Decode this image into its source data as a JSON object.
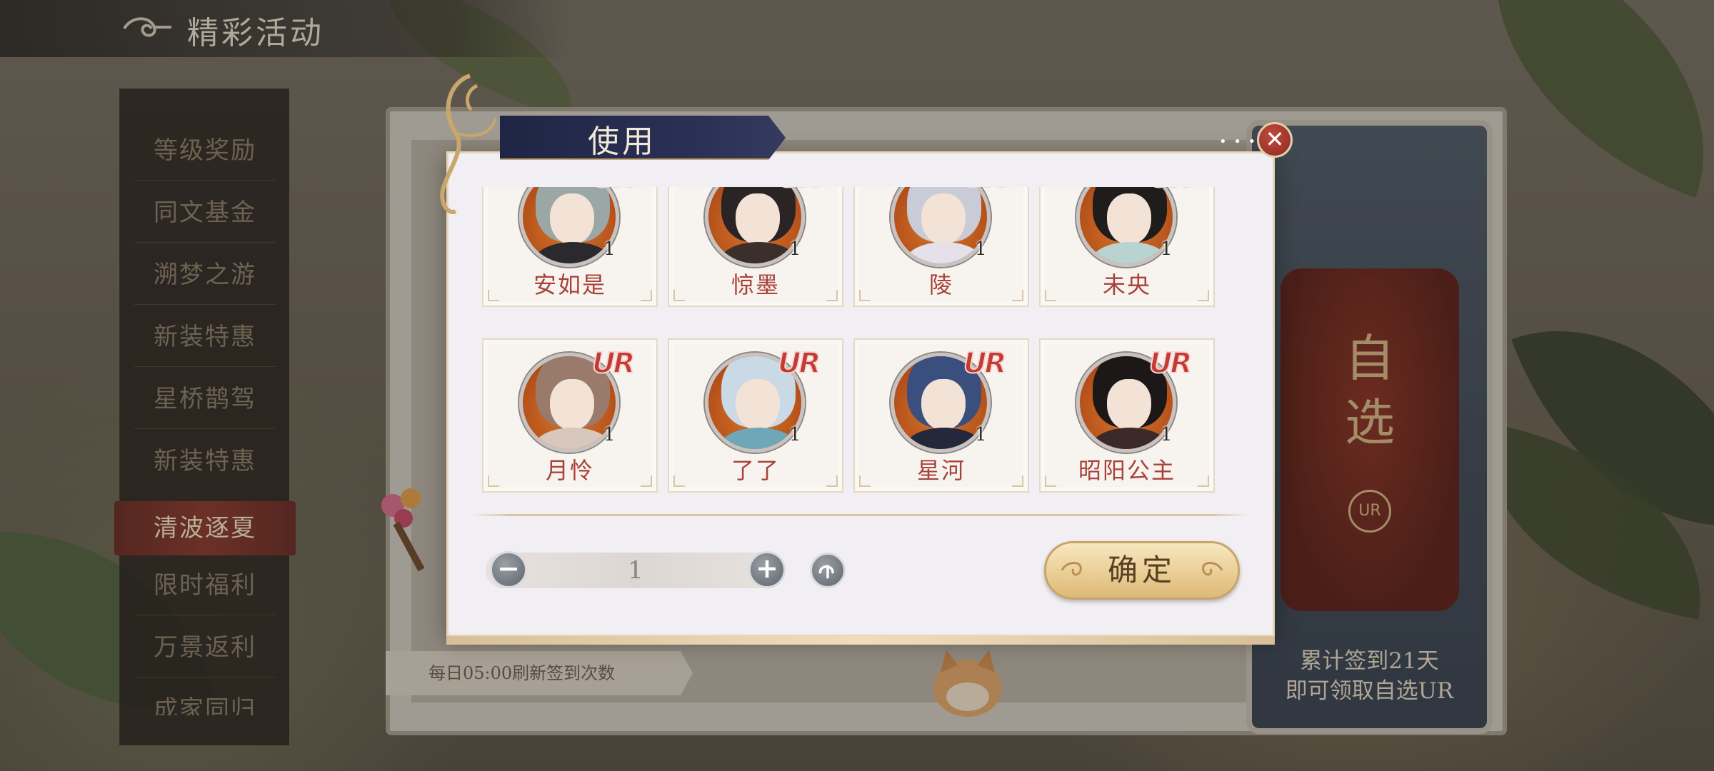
{
  "header": {
    "title": "精彩活动"
  },
  "side_menu": {
    "items": [
      {
        "label": "等级奖励",
        "active": false
      },
      {
        "label": "同文基金",
        "active": false
      },
      {
        "label": "溯梦之游",
        "active": false
      },
      {
        "label": "新装特惠",
        "active": false
      },
      {
        "label": "星桥鹊驾",
        "active": false
      },
      {
        "label": "新装特惠",
        "active": false
      },
      {
        "label": "清波逐夏",
        "active": true
      },
      {
        "label": "限时福利",
        "active": false
      },
      {
        "label": "万景返利",
        "active": false
      },
      {
        "label": "成家同归",
        "active": false
      }
    ]
  },
  "background_panel": {
    "daily_note": "每日05:00刷新签到次数",
    "right_card": {
      "seal_text": [
        "自",
        "选"
      ],
      "seal_badge": "UR",
      "note_line1": "累计签到21天",
      "note_line2": "即可领取自选UR"
    }
  },
  "dialog": {
    "title": "使用",
    "close_icon": "close-icon",
    "items": [
      {
        "name": "安如是",
        "rarity": "UR",
        "qty": "1",
        "hair": "#9aa7a4",
        "outfit": "#2a2a2e"
      },
      {
        "name": "惊墨",
        "rarity": "UR",
        "qty": "1",
        "hair": "#2a2424",
        "outfit": "#3a2f2a"
      },
      {
        "name": "陵",
        "rarity": "UR",
        "qty": "1",
        "hair": "#c9ccd6",
        "outfit": "#e4e1ea"
      },
      {
        "name": "未央",
        "rarity": "UR",
        "qty": "1",
        "hair": "#1f1c1c",
        "outfit": "#b9d3d2"
      },
      {
        "name": "月怜",
        "rarity": "UR",
        "qty": "1",
        "hair": "#9a7a6a",
        "outfit": "#d8c7bd"
      },
      {
        "name": "了了",
        "rarity": "UR",
        "qty": "1",
        "hair": "#c9d9e6",
        "outfit": "#6fa7b8"
      },
      {
        "name": "星河",
        "rarity": "UR",
        "qty": "1",
        "hair": "#3b4f7e",
        "outfit": "#23283a"
      },
      {
        "name": "昭阳公主",
        "rarity": "UR",
        "qty": "1",
        "hair": "#1d1818",
        "outfit": "#3c2a2a"
      }
    ],
    "stepper": {
      "minus_icon": "minus-icon",
      "value": "1",
      "plus_icon": "plus-icon",
      "max_icon": "max-arrow-icon"
    },
    "confirm_label": "确定"
  },
  "colors": {
    "rarity_ur": "#c53a34",
    "name_text": "#a9413a",
    "active_menu": "#8b3a2e",
    "dialog_tab": "#2a3155"
  }
}
